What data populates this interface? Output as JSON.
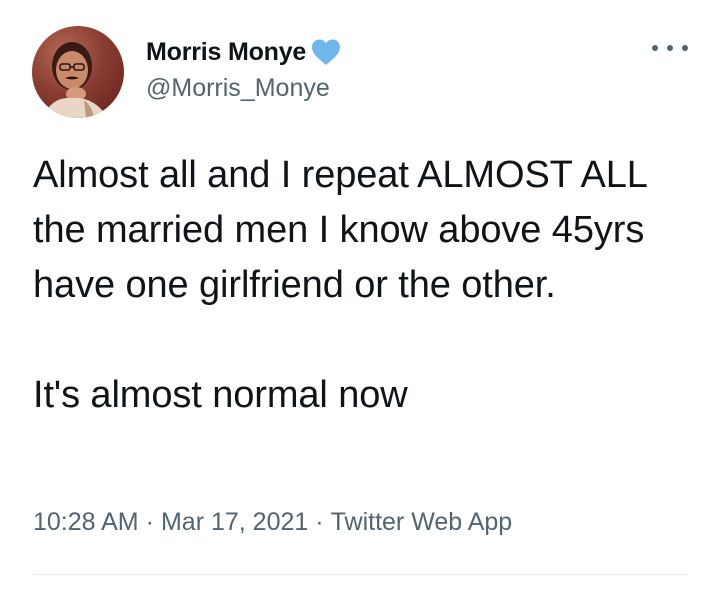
{
  "tweet": {
    "author": {
      "display_name": "Morris Monye",
      "handle": "@Morris_Monye",
      "verified_color": "#6fb8ee"
    },
    "menu_icon": "more-horizontal-icon",
    "text": {
      "paragraph_1": "Almost all and I repeat ALMOST ALL the married men I know above 45yrs have one girlfriend or the other.",
      "paragraph_2": "It's almost normal now"
    },
    "meta": {
      "time": "10:28 AM",
      "separator": "·",
      "date": "Mar 17, 2021",
      "source": "Twitter Web App"
    }
  },
  "colors": {
    "text_primary": "#0f1419",
    "text_secondary": "#536471",
    "divider": "#e6e9eb"
  }
}
